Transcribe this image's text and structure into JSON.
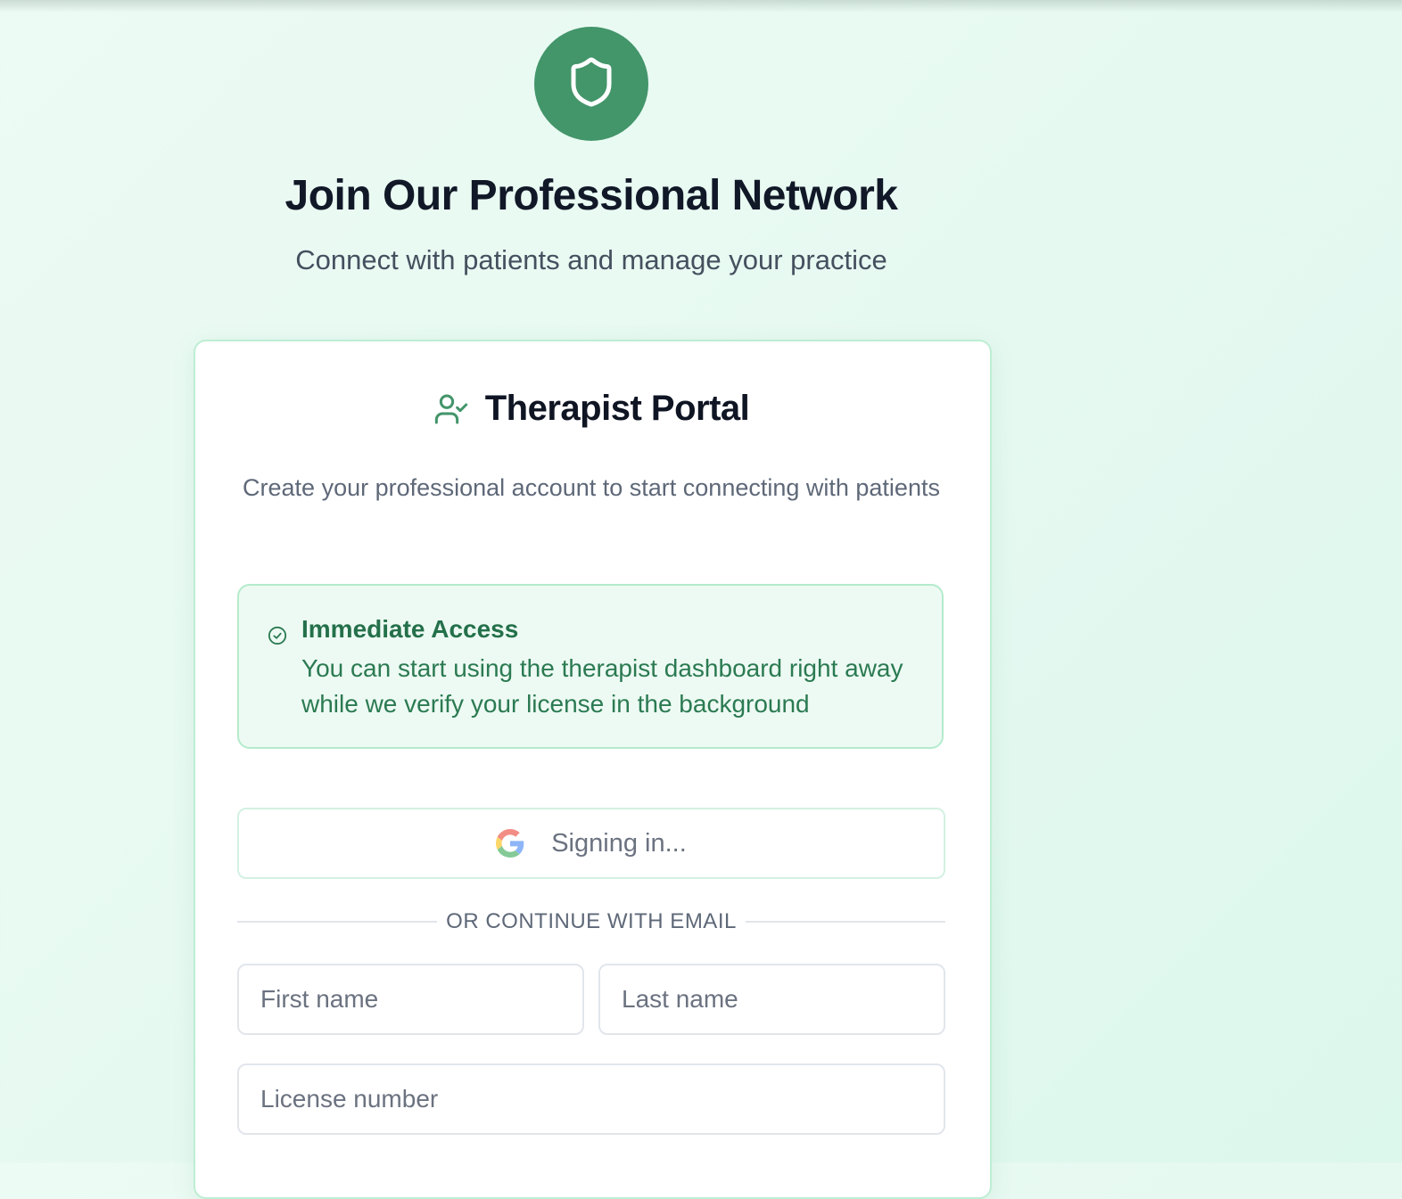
{
  "header": {
    "logo_icon": "shield-icon",
    "title": "Join Our Professional Network",
    "subtitle": "Connect with patients and manage your practice"
  },
  "card": {
    "icon": "user-check-icon",
    "title": "Therapist Portal",
    "description": "Create your professional account to start connecting with patients"
  },
  "notice": {
    "icon": "check-circle-icon",
    "title": "Immediate Access",
    "text": "You can start using the therapist dashboard right away while we verify your license in the background"
  },
  "google_button": {
    "icon": "google-icon",
    "label": "Signing in..."
  },
  "divider": {
    "text": "OR CONTINUE WITH EMAIL"
  },
  "form": {
    "first_name_placeholder": "First name",
    "last_name_placeholder": "Last name",
    "license_placeholder": "License number"
  },
  "colors": {
    "brand": "#43956a",
    "notice_bg": "#edfaf3",
    "notice_text": "#2b7a52",
    "card_border": "#bdeed3"
  }
}
